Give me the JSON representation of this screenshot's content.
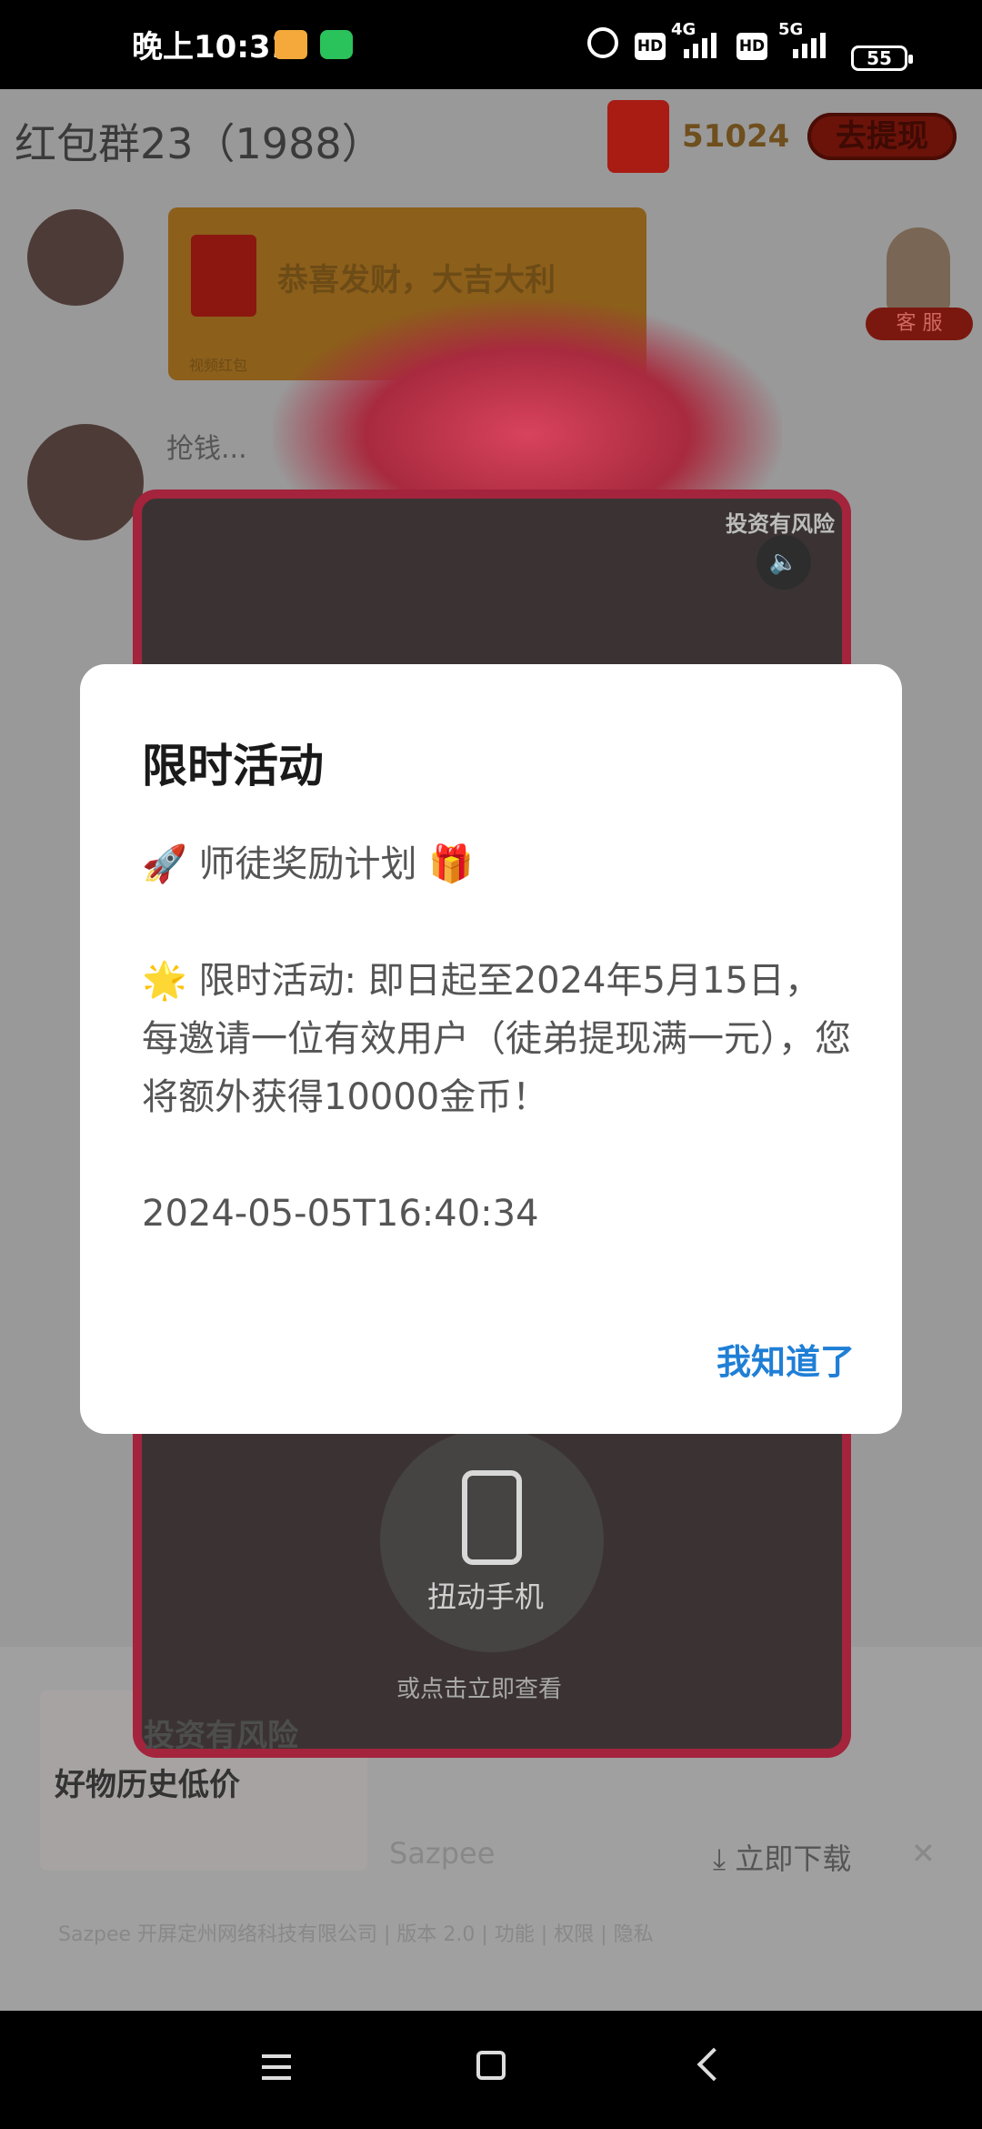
{
  "status_bar": {
    "time": "晚上10:31",
    "network_1": "4G",
    "network_2": "5G",
    "hd_1": "HD",
    "hd_2": "HD",
    "battery": "55"
  },
  "header": {
    "group_title": "红包群23（1988）",
    "coin_count": "51024",
    "withdraw_label": "去提现"
  },
  "chat": {
    "message_text": "恭喜发财，大吉大利",
    "message_sub": "视频红包",
    "customer_service_label": "客 服",
    "grab_text": "抢钱..."
  },
  "ad": {
    "risk_top": "投资有风险",
    "shake_label": "扭动手机",
    "or_click": "或点击立即查看",
    "risk_bottom": "投资有风险",
    "banner_image_text": "好物历史低价",
    "banner_app": "Sazpee",
    "download_label": "立即下载",
    "footer": "Sazpee 开屏定州网络科技有限公司 | 版本 2.0 | 功能 | 权限 | 隐私"
  },
  "dialog": {
    "title": "限时活动",
    "line1": "🚀 师徒奖励计划 🎁",
    "body": "🌟 限时活动: 即日起至2024年5月15日，每邀请一位有效用户（徒弟提现满一元），您将额外获得10000金币！",
    "timestamp": "2024-05-05T16:40:34",
    "ok_label": "我知道了"
  },
  "colors": {
    "accent_button": "#1f7fd6",
    "red_packet": "#a81c14"
  },
  "icons": [
    "alarm-icon",
    "notification-app-icon",
    "wechat-icon",
    "signal-icon",
    "battery-icon",
    "sound-icon",
    "phone-shake-icon",
    "download-icon",
    "close-icon",
    "menu-icon",
    "home-icon",
    "back-icon"
  ]
}
